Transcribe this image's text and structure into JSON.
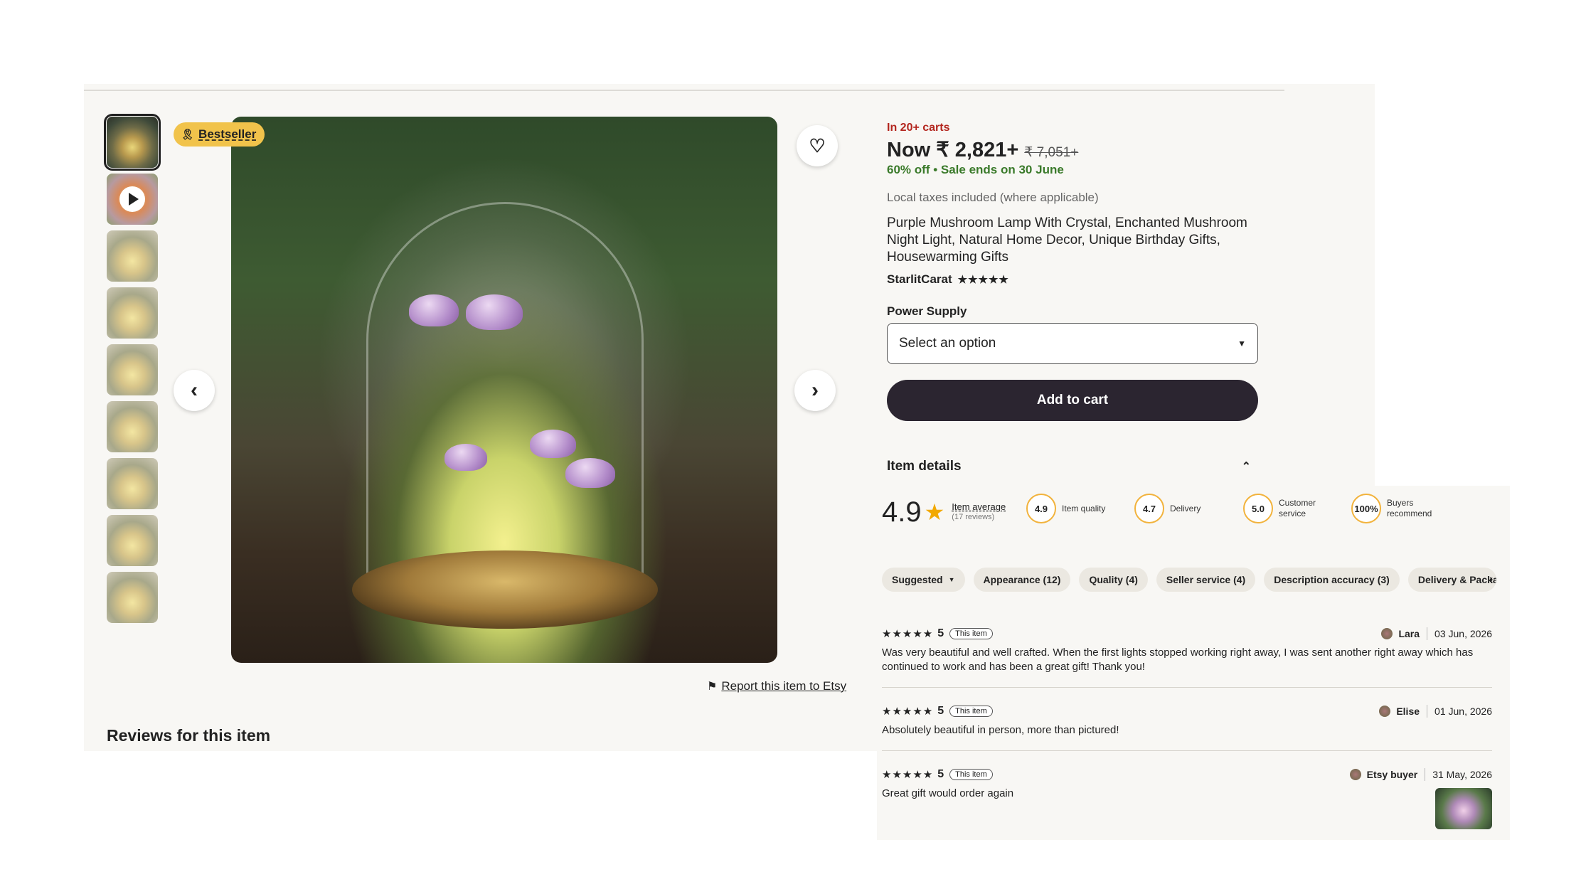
{
  "product_gallery": {
    "badge": "Bestseller",
    "report_link": "Report this item to Etsy",
    "reviews_heading": "Reviews for this item"
  },
  "product": {
    "in_carts": "In 20+ carts",
    "price_now": "Now ₹ 2,821+",
    "price_original": "₹ 7,051+",
    "discount": "60% off",
    "sale_ends": "Sale ends on 30 June",
    "taxes_note": "Local taxes included (where applicable)",
    "title": "Purple Mushroom Lamp With Crystal, Enchanted Mushroom Night Light, Natural Home Decor, Unique Birthday Gifts, Housewarming Gifts",
    "shop_name": "StarlitCarat",
    "shop_stars": "★★★★★",
    "power_supply_label": "Power Supply",
    "select_placeholder": "Select an option",
    "add_to_cart": "Add to cart",
    "item_details": "Item details"
  },
  "ratings": {
    "average": "4.9",
    "average_label": "Item average",
    "review_count": "(17 reviews)",
    "metrics": [
      {
        "value": "4.9",
        "label": "Item quality"
      },
      {
        "value": "4.7",
        "label": "Delivery"
      },
      {
        "value": "5.0",
        "label": "Customer service"
      },
      {
        "value": "100%",
        "label": "Buyers recommend"
      }
    ]
  },
  "filters": {
    "chips": [
      "Suggested",
      "Appearance (12)",
      "Quality (4)",
      "Seller service (4)",
      "Description accuracy (3)",
      "Delivery & Packaging"
    ]
  },
  "reviews": [
    {
      "stars": "★★★★★",
      "rating": "5",
      "tag": "This item",
      "name": "Lara",
      "date": "03 Jun, 2026",
      "text": "Was very beautiful and well crafted. When the first lights stopped working right away, I was sent another right away which has continued to work and has been a great gift! Thank you!"
    },
    {
      "stars": "★★★★★",
      "rating": "5",
      "tag": "This item",
      "name": "Elise",
      "date": "01 Jun, 2026",
      "text": "Absolutely beautiful in person, more than pictured!"
    },
    {
      "stars": "★★★★★",
      "rating": "5",
      "tag": "This item",
      "name": "Etsy buyer",
      "date": "31 May, 2026",
      "text": "Great gift would order again"
    }
  ],
  "colors": {
    "accent_red": "#b3261e",
    "sale_green": "#3a7a2a",
    "cart_button": "#2b2530",
    "badge_yellow": "#f1c34b",
    "star_gold": "#f2a900"
  }
}
